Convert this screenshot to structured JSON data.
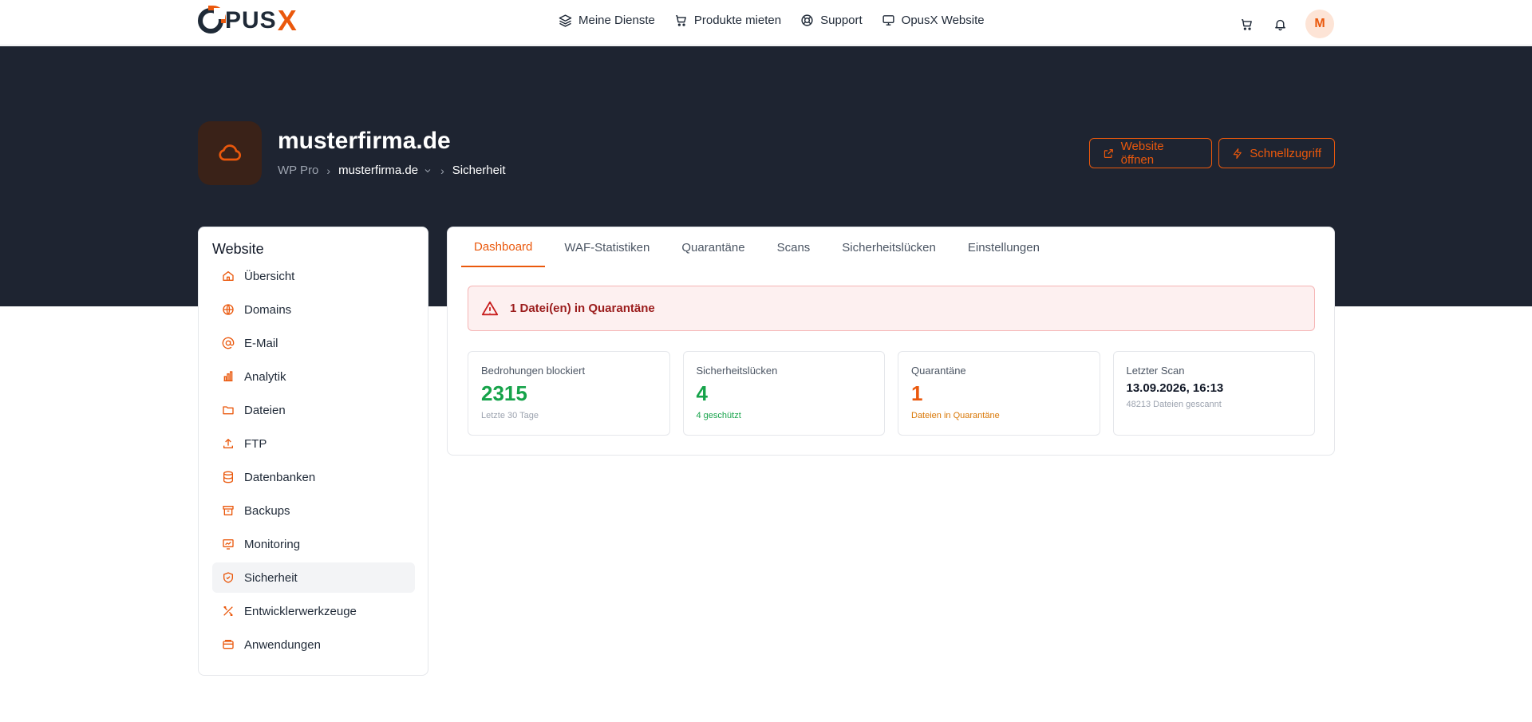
{
  "brand": {
    "logo_text": "OpusX",
    "accent": "#ea580c"
  },
  "nav": [
    {
      "label": "Meine Dienste",
      "icon": "layers-icon"
    },
    {
      "label": "Produkte mieten",
      "icon": "cart-icon"
    },
    {
      "label": "Support",
      "icon": "lifebuoy-icon"
    },
    {
      "label": "OpusX Website",
      "icon": "monitor-icon"
    }
  ],
  "user": {
    "initial": "M"
  },
  "site": {
    "title": "musterfirma.de",
    "breadcrumb": {
      "plan": "WP Pro",
      "domain": "musterfirma.de",
      "current": "Sicherheit"
    }
  },
  "actions": {
    "open_site": "Website öffnen",
    "quick_access": "Schnellzugriff"
  },
  "sidebar": {
    "heading": "Website",
    "items": [
      {
        "label": "Übersicht",
        "icon": "home-icon"
      },
      {
        "label": "Domains",
        "icon": "globe-icon"
      },
      {
        "label": "E-Mail",
        "icon": "at-icon"
      },
      {
        "label": "Analytik",
        "icon": "bar-chart-icon"
      },
      {
        "label": "Dateien",
        "icon": "folder-icon"
      },
      {
        "label": "FTP",
        "icon": "upload-icon"
      },
      {
        "label": "Datenbanken",
        "icon": "database-icon"
      },
      {
        "label": "Backups",
        "icon": "archive-icon"
      },
      {
        "label": "Monitoring",
        "icon": "monitor-chart-icon"
      },
      {
        "label": "Sicherheit",
        "icon": "shield-icon",
        "active": true
      },
      {
        "label": "Entwicklerwerkzeuge",
        "icon": "tools-icon"
      },
      {
        "label": "Anwendungen",
        "icon": "app-window-icon"
      }
    ]
  },
  "tabs": [
    "Dashboard",
    "WAF-Statistiken",
    "Quarantäne",
    "Scans",
    "Sicherheitslücken",
    "Einstellungen"
  ],
  "alert": {
    "text": "1 Datei(en) in Quarantäne"
  },
  "stats": [
    {
      "label": "Bedrohungen blockiert",
      "value": "2315",
      "sub": "Letzte 30 Tage"
    },
    {
      "label": "Sicherheitslücken",
      "value": "4",
      "sub": "4 geschützt"
    },
    {
      "label": "Quarantäne",
      "value": "1",
      "sub": "Dateien in Quarantäne"
    },
    {
      "label": "Letzter Scan",
      "value": "13.09.2026, 16:13",
      "sub": "48213 Dateien gescannt"
    }
  ]
}
